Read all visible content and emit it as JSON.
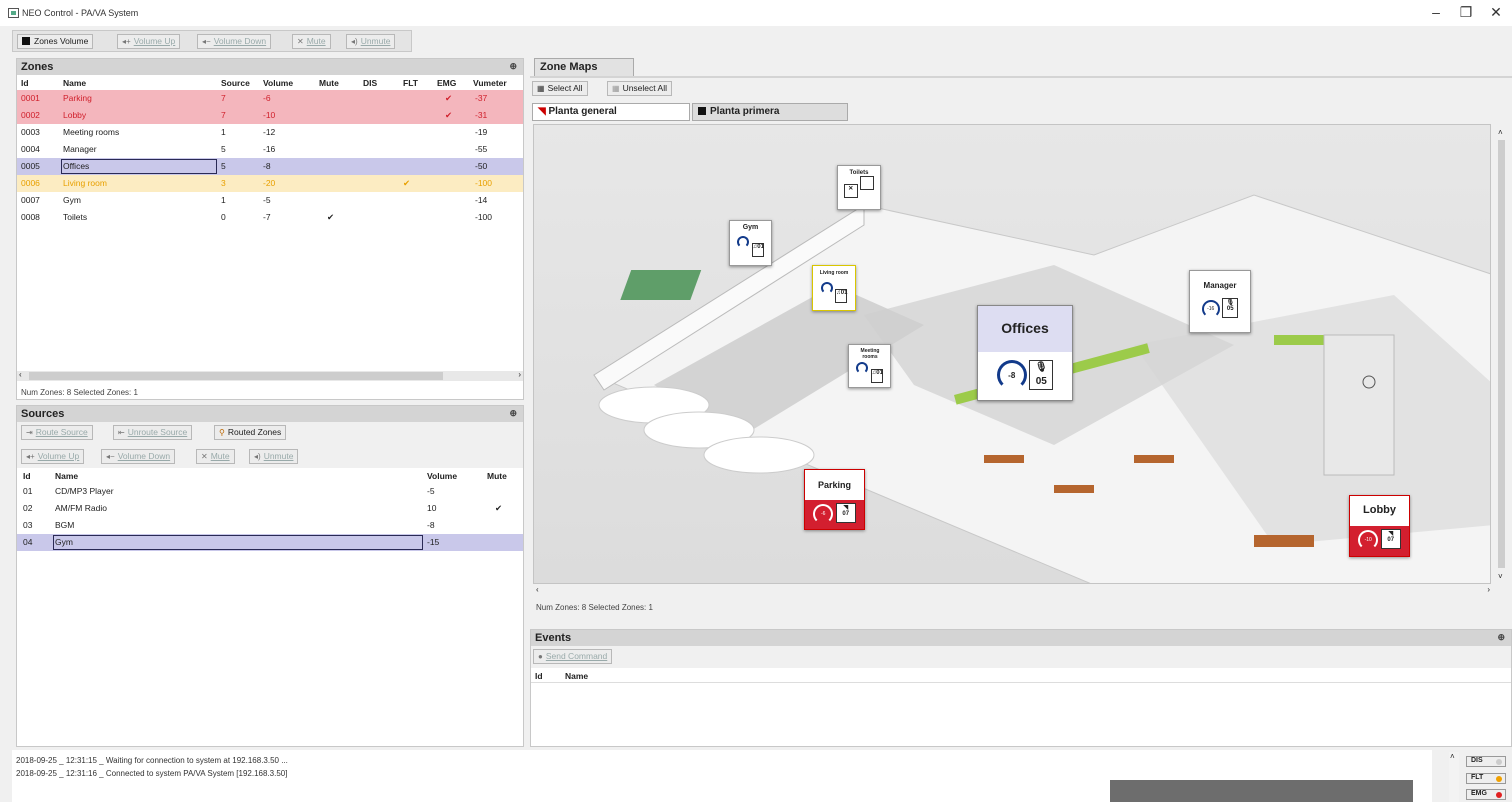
{
  "window": {
    "title": "NEO Control - PA/VA System",
    "minimize": "–",
    "restore": "❐",
    "close": "✕"
  },
  "toolbar": {
    "zones_volume": "Zones Volume",
    "volume_up": "Volume Up",
    "volume_down": "Volume Down",
    "mute": "Mute",
    "unmute": "Unmute"
  },
  "zones": {
    "title": "Zones",
    "pin": "⊕",
    "headers": {
      "id": "Id",
      "name": "Name",
      "source": "Source",
      "volume": "Volume",
      "mute": "Mute",
      "dis": "DIS",
      "flt": "FLT",
      "emg": "EMG",
      "vumeter": "Vumeter"
    },
    "rows": [
      {
        "id": "0001",
        "name": "Parking",
        "source": "7",
        "volume": "-6",
        "mute": "",
        "dis": "",
        "flt": "",
        "emg": "✔",
        "vumeter": "-37",
        "state": "red"
      },
      {
        "id": "0002",
        "name": "Lobby",
        "source": "7",
        "volume": "-10",
        "mute": "",
        "dis": "",
        "flt": "",
        "emg": "✔",
        "vumeter": "-31",
        "state": "red"
      },
      {
        "id": "0003",
        "name": "Meeting rooms",
        "source": "1",
        "volume": "-12",
        "mute": "",
        "dis": "",
        "flt": "",
        "emg": "",
        "vumeter": "-19",
        "state": "plain"
      },
      {
        "id": "0004",
        "name": "Manager",
        "source": "5",
        "volume": "-16",
        "mute": "",
        "dis": "",
        "flt": "",
        "emg": "",
        "vumeter": "-55",
        "state": "plain"
      },
      {
        "id": "0005",
        "name": "Offices",
        "source": "5",
        "volume": "-8",
        "mute": "",
        "dis": "",
        "flt": "",
        "emg": "",
        "vumeter": "-50",
        "state": "sel"
      },
      {
        "id": "0006",
        "name": "Living room",
        "source": "3",
        "volume": "-20",
        "mute": "",
        "dis": "",
        "flt": "✔",
        "emg": "",
        "vumeter": "-100",
        "state": "yel"
      },
      {
        "id": "0007",
        "name": "Gym",
        "source": "1",
        "volume": "-5",
        "mute": "",
        "dis": "",
        "flt": "",
        "emg": "",
        "vumeter": "-14",
        "state": "plain"
      },
      {
        "id": "0008",
        "name": "Toilets",
        "source": "0",
        "volume": "-7",
        "mute": "✔",
        "dis": "",
        "flt": "",
        "emg": "",
        "vumeter": "-100",
        "state": "plain"
      }
    ],
    "status": "Num Zones: 8    Selected Zones: 1"
  },
  "sources": {
    "title": "Sources",
    "pin": "⊕",
    "route_source": "Route Source",
    "unroute_source": "Unroute Source",
    "routed_zones": "Routed Zones",
    "volume_up": "Volume Up",
    "volume_down": "Volume Down",
    "mute": "Mute",
    "unmute": "Unmute",
    "headers": {
      "id": "Id",
      "name": "Name",
      "volume": "Volume",
      "mute": "Mute"
    },
    "rows": [
      {
        "id": "01",
        "name": "CD/MP3 Player",
        "volume": "-5",
        "mute": "",
        "state": "plain"
      },
      {
        "id": "02",
        "name": "AM/FM Radio",
        "volume": "10",
        "mute": "✔",
        "state": "plain"
      },
      {
        "id": "03",
        "name": "BGM",
        "volume": "-8",
        "mute": "",
        "state": "plain"
      },
      {
        "id": "04",
        "name": "Gym",
        "volume": "-15",
        "mute": "",
        "state": "sel"
      }
    ]
  },
  "zonemaps": {
    "title": "Zone Maps",
    "select_all": "Select All",
    "unselect_all": "Unselect All",
    "tabs": [
      "Planta general",
      "Planta primera"
    ],
    "status": "Num Zones: 8    Selected Zones: 1",
    "cards": {
      "toilets": {
        "name": "Toilets"
      },
      "gym": {
        "name": "Gym",
        "src": "01"
      },
      "living": {
        "name": "Living room",
        "src": "01"
      },
      "meeting": {
        "name": "Meeting rooms",
        "src": "01"
      },
      "offices": {
        "name": "Offices",
        "vol": "-8",
        "src": "05"
      },
      "manager": {
        "name": "Manager",
        "vol": "-16",
        "src": "05"
      },
      "parking": {
        "name": "Parking",
        "vol": "-6",
        "src": "07"
      },
      "lobby": {
        "name": "Lobby",
        "vol": "-10",
        "src": "07"
      }
    }
  },
  "events": {
    "title": "Events",
    "pin": "⊕",
    "send_command": "Send Command",
    "headers": {
      "id": "Id",
      "name": "Name"
    }
  },
  "log": [
    "2018-09-25 _ 12:31:15 _ Waiting for connection to system at 192.168.3.50 ...",
    "2018-09-25 _ 12:31:16 _ Connected to system PA/VA System [192.168.3.50]"
  ],
  "indicators": [
    {
      "label": "DIS",
      "color": "#cccccc"
    },
    {
      "label": "FLT",
      "color": "#f0a000"
    },
    {
      "label": "EMG",
      "color": "#e02020"
    }
  ]
}
